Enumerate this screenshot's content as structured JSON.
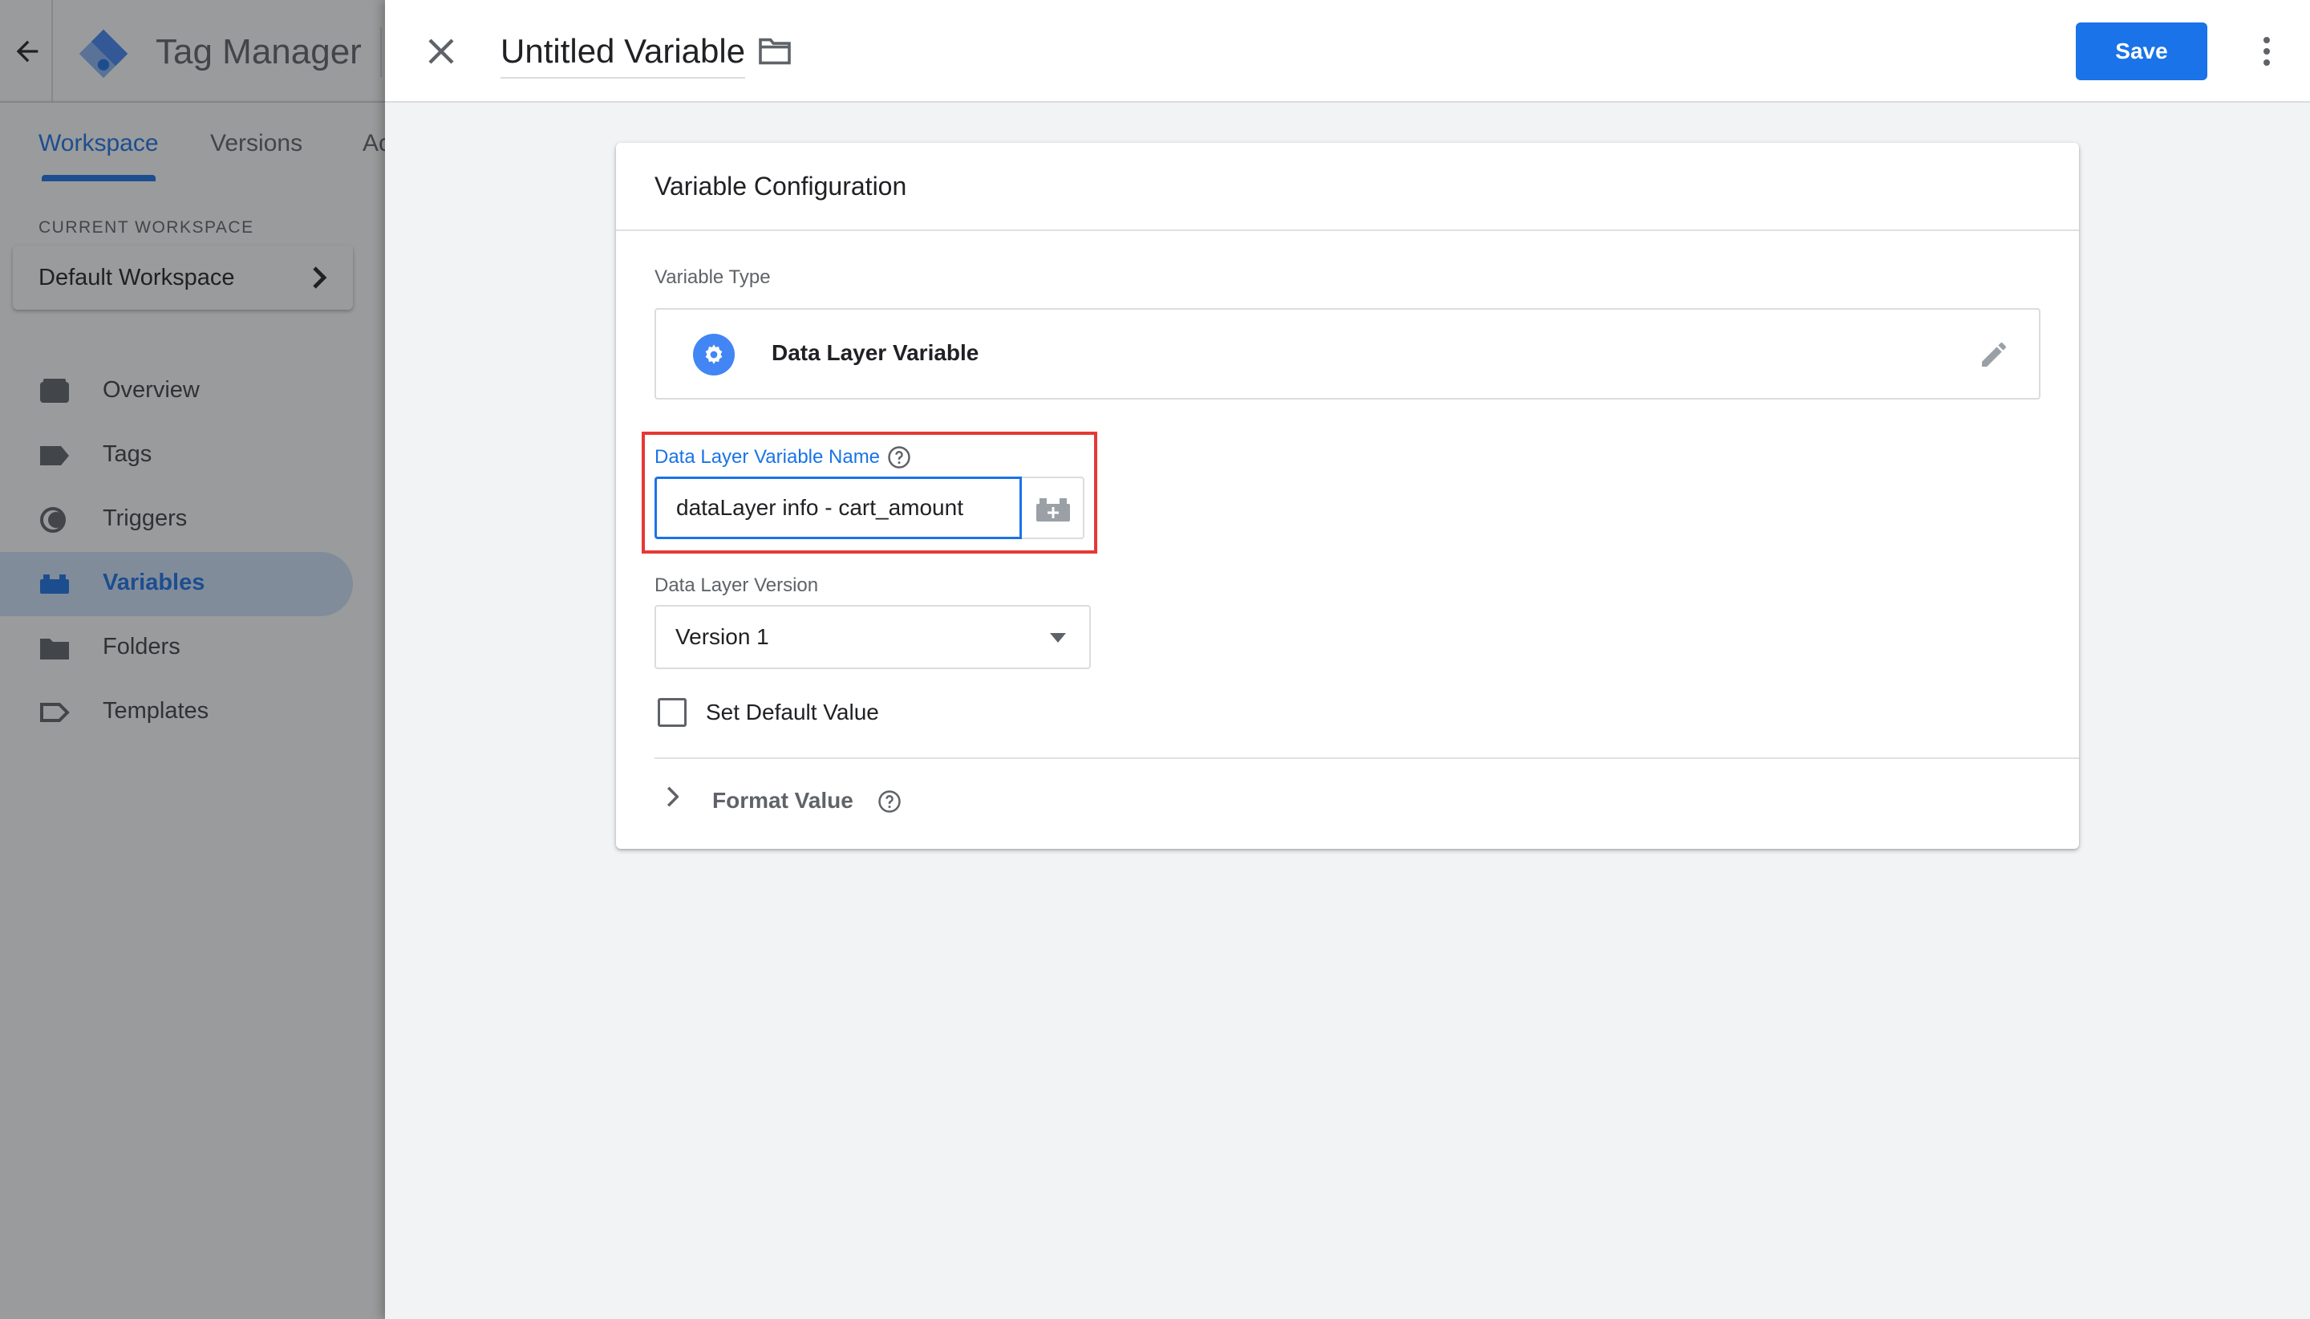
{
  "app": {
    "name": "Tag Manager"
  },
  "tabs": [
    {
      "label": "Workspace",
      "active": true
    },
    {
      "label": "Versions",
      "active": false
    },
    {
      "label": "Ac",
      "active": false
    }
  ],
  "sidebar": {
    "current_workspace_label": "CURRENT WORKSPACE",
    "current_workspace_name": "Default Workspace",
    "items": [
      {
        "label": "Overview",
        "icon": "overview-icon"
      },
      {
        "label": "Tags",
        "icon": "tag-icon"
      },
      {
        "label": "Triggers",
        "icon": "trigger-icon"
      },
      {
        "label": "Variables",
        "icon": "variables-icon",
        "active": true
      },
      {
        "label": "Folders",
        "icon": "folder-icon"
      },
      {
        "label": "Templates",
        "icon": "template-icon"
      }
    ]
  },
  "editor": {
    "title": "Untitled Variable",
    "save_label": "Save",
    "card_title": "Variable Configuration",
    "variable_type_label": "Variable Type",
    "variable_type_name": "Data Layer Variable",
    "dlv_name_label": "Data Layer Variable Name",
    "dlv_name_value": "dataLayer info - cart_amount",
    "dlv_version_label": "Data Layer Version",
    "dlv_version_value": "Version 1",
    "default_value_label": "Set Default Value",
    "default_value_checked": false,
    "format_value_label": "Format Value"
  },
  "colors": {
    "accent": "#1a73e8",
    "highlight": "#e53935",
    "overlay": "#5f6368"
  }
}
